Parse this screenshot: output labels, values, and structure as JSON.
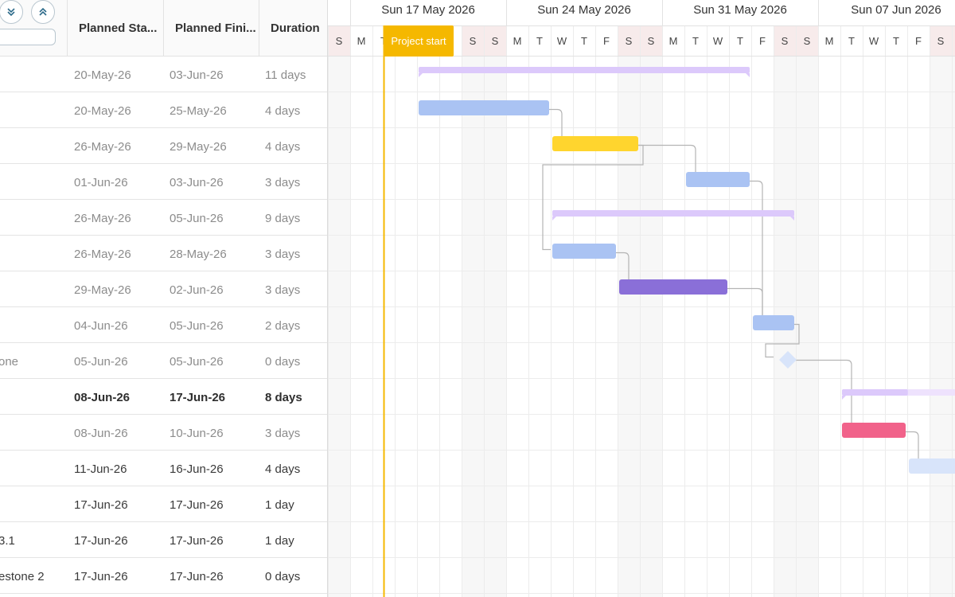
{
  "grid": {
    "columns": {
      "planned_start": "Planned Sta...",
      "planned_finish": "Planned Fini...",
      "duration": "Duration"
    },
    "filter": {
      "value": "",
      "placeholder": ""
    },
    "expand_all_label": "expand-all",
    "collapse_all_label": "collapse-all",
    "rows": [
      {
        "name": "",
        "start": "20-May-26",
        "finish": "03-Jun-26",
        "duration": "11 days",
        "style": "muted"
      },
      {
        "name": "",
        "start": "20-May-26",
        "finish": "25-May-26",
        "duration": "4 days",
        "style": "muted"
      },
      {
        "name": "",
        "start": "26-May-26",
        "finish": "29-May-26",
        "duration": "4 days",
        "style": "muted"
      },
      {
        "name": "",
        "start": "01-Jun-26",
        "finish": "03-Jun-26",
        "duration": "3 days",
        "style": "muted"
      },
      {
        "name": "",
        "start": "26-May-26",
        "finish": "05-Jun-26",
        "duration": "9 days",
        "style": "muted"
      },
      {
        "name": "",
        "start": "26-May-26",
        "finish": "28-May-26",
        "duration": "3 days",
        "style": "muted"
      },
      {
        "name": "",
        "start": "29-May-26",
        "finish": "02-Jun-26",
        "duration": "3 days",
        "style": "muted"
      },
      {
        "name": "",
        "start": "04-Jun-26",
        "finish": "05-Jun-26",
        "duration": "2 days",
        "style": "muted"
      },
      {
        "name": "one",
        "start": "05-Jun-26",
        "finish": "05-Jun-26",
        "duration": "0 days",
        "style": "muted"
      },
      {
        "name": "",
        "start": "08-Jun-26",
        "finish": "17-Jun-26",
        "duration": "8 days",
        "style": "bold"
      },
      {
        "name": "",
        "start": "08-Jun-26",
        "finish": "10-Jun-26",
        "duration": "3 days",
        "style": "muted"
      },
      {
        "name": "",
        "start": "11-Jun-26",
        "finish": "16-Jun-26",
        "duration": "4 days",
        "style": "dark"
      },
      {
        "name": "",
        "start": "17-Jun-26",
        "finish": "17-Jun-26",
        "duration": "1 day",
        "style": "dark"
      },
      {
        "name": "3.1",
        "start": "17-Jun-26",
        "finish": "17-Jun-26",
        "duration": "1 day",
        "style": "dark"
      },
      {
        "name": "estone 2",
        "start": "17-Jun-26",
        "finish": "17-Jun-26",
        "duration": "0 days",
        "style": "dark"
      }
    ]
  },
  "timeline": {
    "weeks": [
      "Sun 17 May 2026",
      "Sun 24 May 2026",
      "Sun 31 May 2026",
      "Sun 07 Jun 2026"
    ],
    "days": [
      "S",
      "M",
      "T",
      "W",
      "T",
      "F",
      "S",
      "S",
      "M",
      "T",
      "W",
      "T",
      "F",
      "S",
      "S",
      "M",
      "T",
      "W",
      "T",
      "F",
      "S",
      "S",
      "M",
      "T",
      "W",
      "T",
      "F",
      "S",
      "S"
    ],
    "project_start_label": "Project start",
    "colors": {
      "project_line": "#f5b800",
      "parent": "#dcc9fb",
      "parent_light": "#eee2fd",
      "task_blue": "#aac3f3",
      "task_blue_light": "#d8e4fa",
      "task_yellow": "#ffd52e",
      "task_purple": "#8a6fd8",
      "task_pink": "#f1628a",
      "milestone": "#d8e4fa",
      "weekend_header": "#f7ebeb",
      "weekend_body": "#f7f7f7"
    }
  },
  "tasks": [
    {
      "row": 0,
      "start": "2026-05-20",
      "finish": "2026-06-03",
      "kind": "parent"
    },
    {
      "row": 1,
      "start": "2026-05-20",
      "finish": "2026-05-25",
      "kind": "blue"
    },
    {
      "row": 2,
      "start": "2026-05-26",
      "finish": "2026-05-29",
      "kind": "yellow"
    },
    {
      "row": 3,
      "start": "2026-06-01",
      "finish": "2026-06-03",
      "kind": "blue"
    },
    {
      "row": 4,
      "start": "2026-05-26",
      "finish": "2026-06-05",
      "kind": "parent"
    },
    {
      "row": 5,
      "start": "2026-05-26",
      "finish": "2026-05-28",
      "kind": "blue"
    },
    {
      "row": 6,
      "start": "2026-05-29",
      "finish": "2026-06-02",
      "kind": "purple"
    },
    {
      "row": 7,
      "start": "2026-06-04",
      "finish": "2026-06-05",
      "kind": "blue"
    },
    {
      "row": 8,
      "start": "2026-06-05",
      "finish": "2026-06-05",
      "kind": "milestone"
    },
    {
      "row": 9,
      "start": "2026-06-08",
      "finish": "2026-06-17",
      "kind": "parent_partial"
    },
    {
      "row": 10,
      "start": "2026-06-08",
      "finish": "2026-06-10",
      "kind": "pink"
    },
    {
      "row": 11,
      "start": "2026-06-11",
      "finish": "2026-06-16",
      "kind": "blue_light"
    }
  ],
  "dependencies": [
    {
      "from": 1,
      "to": 2
    },
    {
      "from": 2,
      "to": 3
    },
    {
      "from": 2,
      "to": 5
    },
    {
      "from": 5,
      "to": 6
    },
    {
      "from": 6,
      "to": 7
    },
    {
      "from": 3,
      "to": 7
    },
    {
      "from": 7,
      "to": 8
    },
    {
      "from": 8,
      "to": 10
    },
    {
      "from": 10,
      "to": 11
    }
  ]
}
